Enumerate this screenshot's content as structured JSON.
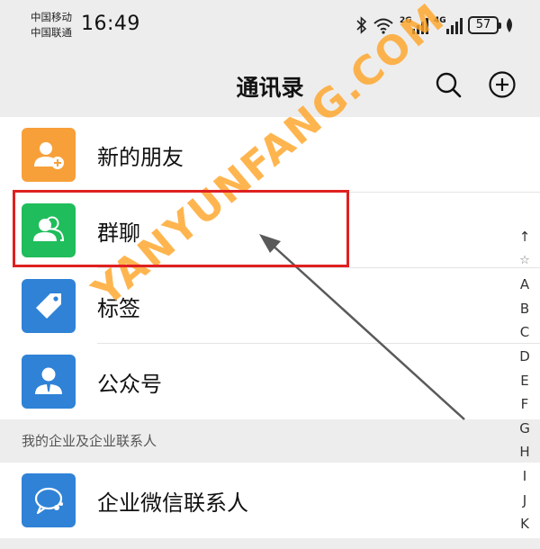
{
  "status_bar": {
    "carrier_1": "中国移动",
    "carrier_2": "中国联通",
    "time": "16:49",
    "network_1": "2G",
    "network_2": "4G",
    "battery": "57"
  },
  "header": {
    "title": "通讯录"
  },
  "list": {
    "new_friends": "新的朋友",
    "group_chats": "群聊",
    "tags": "标签",
    "official_accounts": "公众号"
  },
  "section": {
    "title": "我的企业及企业联系人"
  },
  "work_contacts": {
    "label": "企业微信联系人"
  },
  "index_bar": [
    "↑",
    "☆",
    "A",
    "B",
    "C",
    "D",
    "E",
    "F",
    "G",
    "H",
    "I",
    "J",
    "K"
  ],
  "watermark": "YANYUNFANG.COM",
  "colors": {
    "orange": "#f7a03a",
    "green": "#1fbd5b",
    "blue": "#2f82d6",
    "highlight": "#e02020"
  }
}
